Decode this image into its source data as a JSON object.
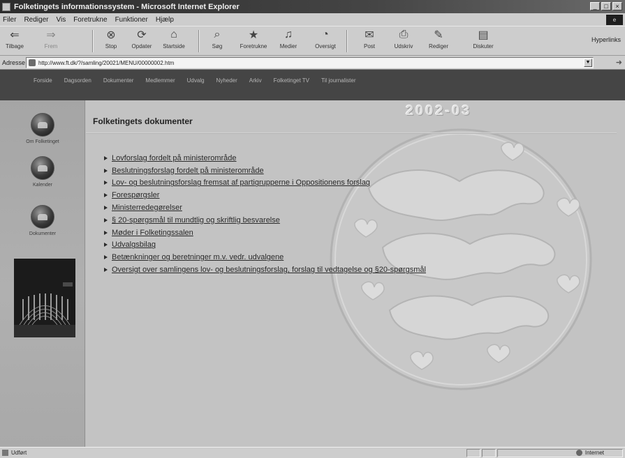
{
  "window": {
    "title": "Folketingets informationssystem - Microsoft Internet Explorer",
    "controls": [
      "_",
      "□",
      "×"
    ]
  },
  "menubar": {
    "items": [
      "Filer",
      "Rediger",
      "Vis",
      "Foretrukne",
      "Funktioner",
      "Hjælp"
    ]
  },
  "toolbar": {
    "buttons": [
      {
        "label": "Tilbage",
        "icon": "back-arrow-icon"
      },
      {
        "label": "Frem",
        "icon": "forward-arrow-icon"
      },
      {
        "label": "Stop",
        "icon": "stop-icon"
      },
      {
        "label": "Opdater",
        "icon": "refresh-icon"
      },
      {
        "label": "Startside",
        "icon": "home-icon"
      },
      {
        "label": "Søg",
        "icon": "search-icon"
      },
      {
        "label": "Foretrukne",
        "icon": "favorites-icon"
      },
      {
        "label": "Medier",
        "icon": "media-icon"
      },
      {
        "label": "Oversigt",
        "icon": "history-icon"
      },
      {
        "label": "Post",
        "icon": "mail-icon"
      },
      {
        "label": "Udskriv",
        "icon": "print-icon"
      },
      {
        "label": "Rediger",
        "icon": "edit-icon"
      },
      {
        "label": "Diskuter",
        "icon": "discuss-icon"
      }
    ],
    "links_label": "Hyperlinks"
  },
  "addressbar": {
    "label": "Adresse",
    "url": "http://www.ft.dk/?/samling/20021/MENU/00000002.htm"
  },
  "sitenav": {
    "items": [
      "Forside",
      "Dagsorden",
      "Dokumenter",
      "Medlemmer",
      "Udvalg",
      "Nyheder",
      "Arkiv",
      "Folketinget TV",
      "Til journalister"
    ]
  },
  "sidebar": {
    "items": [
      {
        "label": "Om Folketinget"
      },
      {
        "label": "Kalender"
      },
      {
        "label": "Dokumenter"
      }
    ]
  },
  "main": {
    "year": "2002-03",
    "title": "Folketingets dokumenter",
    "links": [
      "Lovforslag fordelt på ministerområde",
      "Beslutningsforslag fordelt på ministerområde",
      "Lov- og beslutningsforslag fremsat af partigrupperne i Oppositionens forslag",
      "Forespørgsler",
      "Ministerredegørelser",
      "§ 20-spørgsmål til mundtlig og skriftlig besvarelse",
      "Møder i Folketingssalen",
      "Udvalgsbilag",
      "Betænkninger og beretninger m.v. vedr. udvalgene",
      "Oversigt over samlingens lov- og beslutningsforslag, forslag til vedtagelse og §20-spørgsmål"
    ]
  },
  "statusbar": {
    "text": "Udført",
    "zone": "Internet"
  },
  "colors": {
    "page_bg": "#c3c3c3",
    "sidebar_bg": "#a9a9a9",
    "nav_bg": "#454545",
    "link": "#2a2a2a"
  }
}
